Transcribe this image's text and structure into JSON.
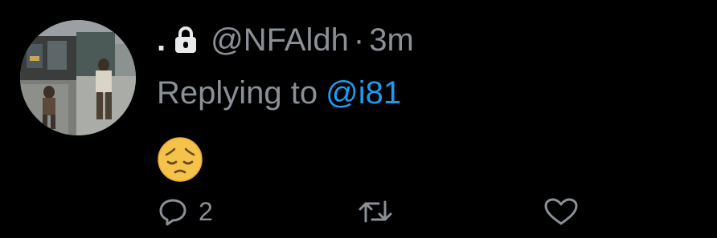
{
  "tweet": {
    "display_name": ".",
    "handle": "@NFAldh",
    "separator": "·",
    "time": "3m",
    "locked_icon": "lock-icon",
    "replying_prefix": "Replying to",
    "replying_to": "@i81",
    "content_emoji": "😔",
    "actions": {
      "reply_count": "2",
      "reply_icon": "reply-icon",
      "retweet_icon": "retweet-icon",
      "like_icon": "heart-icon"
    }
  },
  "colors": {
    "background": "#000000",
    "text_primary": "#e7e9ea",
    "text_secondary": "#8b9096",
    "link": "#1d9bf0",
    "emoji_face": "#f6c34a"
  }
}
